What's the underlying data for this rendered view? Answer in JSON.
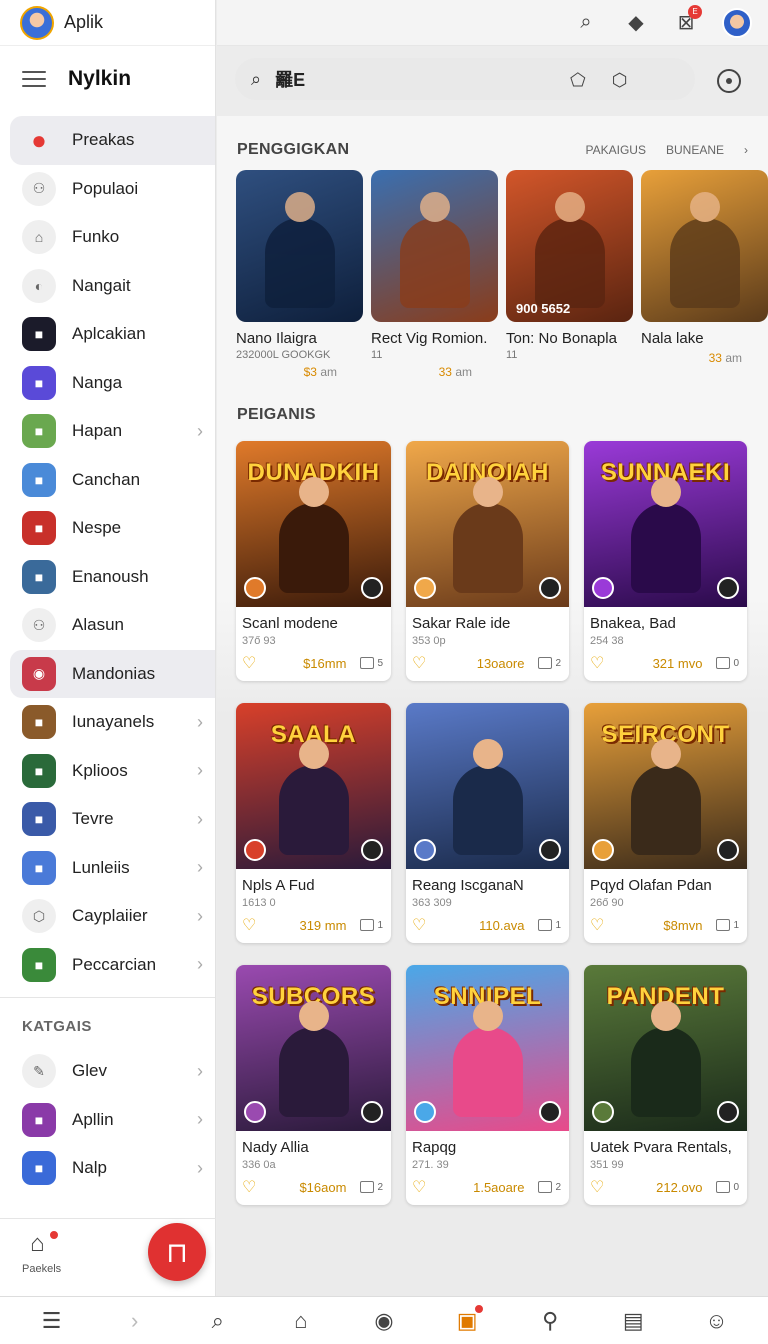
{
  "app": {
    "name": "Aplik",
    "menu_title": "Nylkin"
  },
  "sidebar": {
    "items": [
      {
        "label": "Preakas",
        "active": true,
        "icon": "dots-icon"
      },
      {
        "label": "Populaoi",
        "icon": "people-icon"
      },
      {
        "label": "Funko",
        "icon": "house-icon"
      },
      {
        "label": "Nangait",
        "icon": "ball-icon"
      },
      {
        "label": "Aplcakian",
        "icon": "app-icon"
      },
      {
        "label": "Nanga",
        "icon": "app-icon"
      },
      {
        "label": "Hapan",
        "icon": "app-icon",
        "chevron": true
      },
      {
        "label": "Canchan",
        "icon": "app-icon"
      },
      {
        "label": "Nespe",
        "icon": "app-icon"
      },
      {
        "label": "Enanoush",
        "icon": "app-icon"
      },
      {
        "label": "Alasun",
        "icon": "people-icon"
      },
      {
        "label": "Mandonias",
        "active": true,
        "icon": "circle-icon"
      },
      {
        "label": "Iunayanels",
        "icon": "app-icon",
        "chevron": true
      },
      {
        "label": "Kplioos",
        "icon": "app-icon",
        "chevron": true
      },
      {
        "label": "Tevre",
        "icon": "app-icon",
        "chevron": true
      },
      {
        "label": "Lunleiis",
        "icon": "app-icon",
        "chevron": true
      },
      {
        "label": "Cayplaiier",
        "icon": "shield-icon",
        "chevron": true
      },
      {
        "label": "Peccarcian",
        "icon": "app-icon",
        "chevron": true
      }
    ],
    "section_label": "KATGAIS",
    "section_items": [
      {
        "label": "Glev",
        "icon": "pencil-icon",
        "chevron": true
      },
      {
        "label": "Apllin",
        "icon": "app-icon",
        "chevron": true
      },
      {
        "label": "Nalp",
        "icon": "app-icon",
        "chevron": true
      }
    ],
    "bottom": {
      "home_label": "Paekels",
      "fab_glyph": "⊓"
    }
  },
  "search": {
    "text": "䍦E"
  },
  "featured": {
    "title": "PENGGIGKAN",
    "links": [
      "PAKAIGUS",
      "BUNEANE"
    ],
    "items": [
      {
        "name": "Nano Ilaigra",
        "sub": "232000L GOOKGK",
        "price": "$3",
        "unit": "am",
        "colors": [
          "#2f4f7f",
          "#0e1f3b"
        ]
      },
      {
        "name": "Rect Vig Romion.",
        "sub": "11",
        "price": "33",
        "unit": "am",
        "colors": [
          "#3a6fb0",
          "#8a3c1a"
        ]
      },
      {
        "name": "Ton: No Bonapla",
        "sub": "11",
        "price": "",
        "unit": "",
        "overlay": "900 5652",
        "colors": [
          "#d2562a",
          "#5a2410"
        ]
      },
      {
        "name": "Nala lake",
        "sub": "",
        "price": "33",
        "unit": "am",
        "colors": [
          "#e8a03a",
          "#5a3a1a"
        ]
      }
    ]
  },
  "grid": {
    "title": "PEIGANIS",
    "cards": [
      {
        "name": "Scanl modene",
        "sub": "37ő 93",
        "price": "$16mm",
        "count": "5",
        "art": "DUNADKIH",
        "colors": [
          "#e07a2a",
          "#3a1a0a"
        ]
      },
      {
        "name": "Sakar Rale ide",
        "sub": "353 0p",
        "price": "13oaore",
        "count": "2",
        "art": "DAINOIAH",
        "colors": [
          "#f0a84a",
          "#6a3a1a"
        ]
      },
      {
        "name": "Bnakea, Bad",
        "sub": "254 38",
        "price": "321 mvo",
        "count": "0",
        "art": "SUNNAEKI",
        "colors": [
          "#9a3ad8",
          "#2a0a4a"
        ]
      },
      {
        "name": "Npls A Fud",
        "sub": "1613 0",
        "price": "319 mm",
        "count": "1",
        "art": "SAALA",
        "colors": [
          "#d8402a",
          "#2a1a3a"
        ]
      },
      {
        "name": "Reang IscganaN",
        "sub": "363 309",
        "price": "110.ava",
        "count": "1",
        "art": "",
        "colors": [
          "#5a7ac8",
          "#1a2a4a"
        ]
      },
      {
        "name": "Pqyd Olafan Pdan",
        "sub": "26ő 90",
        "price": "$8mvn",
        "count": "1",
        "art": "SEIRCONT",
        "colors": [
          "#e8a03a",
          "#3a2a1a"
        ]
      },
      {
        "name": "Nady Allia",
        "sub": "336 0a",
        "price": "$16aom",
        "count": "2",
        "art": "SUBCORS",
        "colors": [
          "#9a4ab0",
          "#2a1a3a"
        ]
      },
      {
        "name": "Rapqg",
        "sub": "271. 39",
        "price": "1.5aoare",
        "count": "2",
        "art": "SNNIPEL",
        "colors": [
          "#4aa8e8",
          "#e84a8a"
        ]
      },
      {
        "name": "Uatek Pvara Rentals,",
        "sub": "351 99",
        "price": "212.ovo",
        "count": "0",
        "art": "PANDENT",
        "colors": [
          "#5a7a3a",
          "#1a2a1a"
        ]
      }
    ]
  },
  "bottom_nav": [
    "list-icon",
    "chevron-icon",
    "search-icon",
    "home-icon",
    "compass-icon",
    "tv-icon",
    "person-icon",
    "cart-icon",
    "profile-icon"
  ]
}
